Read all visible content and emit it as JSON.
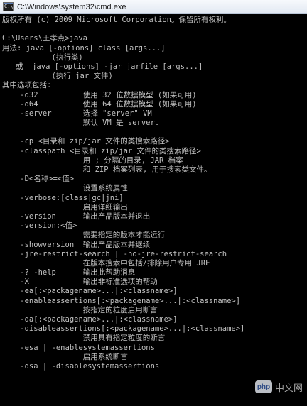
{
  "window": {
    "title": "C:\\Windows\\system32\\cmd.exe",
    "icon": "cmd-icon",
    "icon_glyph": "C:\\"
  },
  "console": {
    "lines": [
      "版权所有 (c) 2009 Microsoft Corporation。保留所有权利。",
      "",
      "C:\\Users\\王孝点>java",
      "用法: java [-options] class [args...]",
      "           (执行类)",
      "   或  java [-options] -jar jarfile [args...]",
      "           (执行 jar 文件)",
      "其中选项包括:",
      "    -d32          使用 32 位数据模型 (如果可用)",
      "    -d64          使用 64 位数据模型 (如果可用)",
      "    -server       选择 \"server\" VM",
      "                  默认 VM 是 server.",
      "",
      "    -cp <目录和 zip/jar 文件的类搜索路径>",
      "    -classpath <目录和 zip/jar 文件的类搜索路径>",
      "                  用 ; 分隔的目录, JAR 档案",
      "                  和 ZIP 档案列表, 用于搜索类文件。",
      "    -D<名称>=<值>",
      "                  设置系统属性",
      "    -verbose:[class|gc|jni]",
      "                  启用详细输出",
      "    -version      输出产品版本并退出",
      "    -version:<值>",
      "                  需要指定的版本才能运行",
      "    -showversion  输出产品版本并继续",
      "    -jre-restrict-search | -no-jre-restrict-search",
      "                  在版本搜索中包括/排除用户专用 JRE",
      "    -? -help      输出此帮助消息",
      "    -X            输出非标准选项的帮助",
      "    -ea[:<packagename>...|:<classname>]",
      "    -enableassertions[:<packagename>...|:<classname>]",
      "                  按指定的粒度启用断言",
      "    -da[:<packagename>...|:<classname>]",
      "    -disableassertions[:<packagename>...|:<classname>]",
      "                  禁用具有指定粒度的断言",
      "    -esa | -enablesystemassertions",
      "                  启用系统断言",
      "    -dsa | -disablesystemassertions"
    ]
  },
  "watermark": {
    "logo_text": "php",
    "text": "中文网"
  },
  "colors": {
    "console_background": "#000000",
    "console_text": "#c0c0c0",
    "titlebar": "#e1e8f2"
  }
}
